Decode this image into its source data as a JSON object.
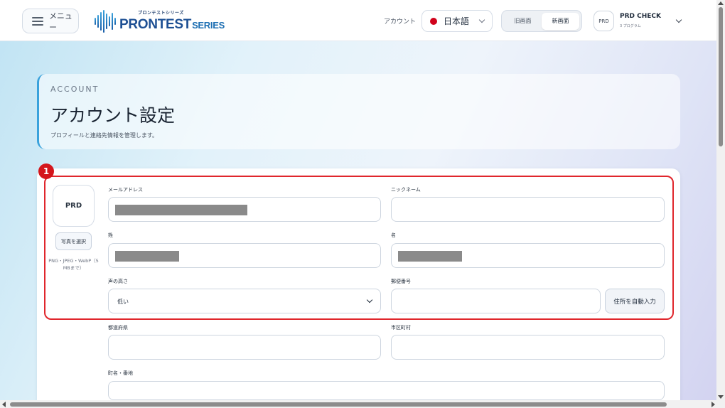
{
  "header": {
    "menu_label": "メニュー",
    "logo_small": "プロンテストシリーズ",
    "logo_main": "PRONTEST",
    "logo_suffix": "SERIES",
    "account_label": "アカウント",
    "language": "日本語",
    "view_old": "旧画面",
    "view_new": "新画面",
    "active_view": "新画面",
    "user_badge": "PRD",
    "user_name": "PRD CHECK",
    "user_sub": "3 プログラム"
  },
  "page": {
    "eyebrow": "ACCOUNT",
    "title": "アカウント設定",
    "subtitle": "プロフィールと連絡先情報を管理します。"
  },
  "profile": {
    "avatar_text": "PRD",
    "photo_button": "写真を選択",
    "photo_hint": "PNG・JPEG・WebP（5 MBまで）"
  },
  "form": {
    "email_label": "メールアドレス",
    "nickname_label": "ニックネーム",
    "last_name_label": "姓",
    "first_name_label": "名",
    "voice_pitch_label": "声の高さ",
    "voice_pitch_value": "低い",
    "postal_code_label": "郵便番号",
    "auto_fill_button": "住所を自動入力",
    "prefecture_label": "都道府県",
    "city_label": "市区町村",
    "street_label": "町名・番地"
  },
  "annotation": {
    "number": "1"
  },
  "colors": {
    "highlight": "#e0262c",
    "accent": "#3aa2dc",
    "brand": "#1d4f93"
  }
}
